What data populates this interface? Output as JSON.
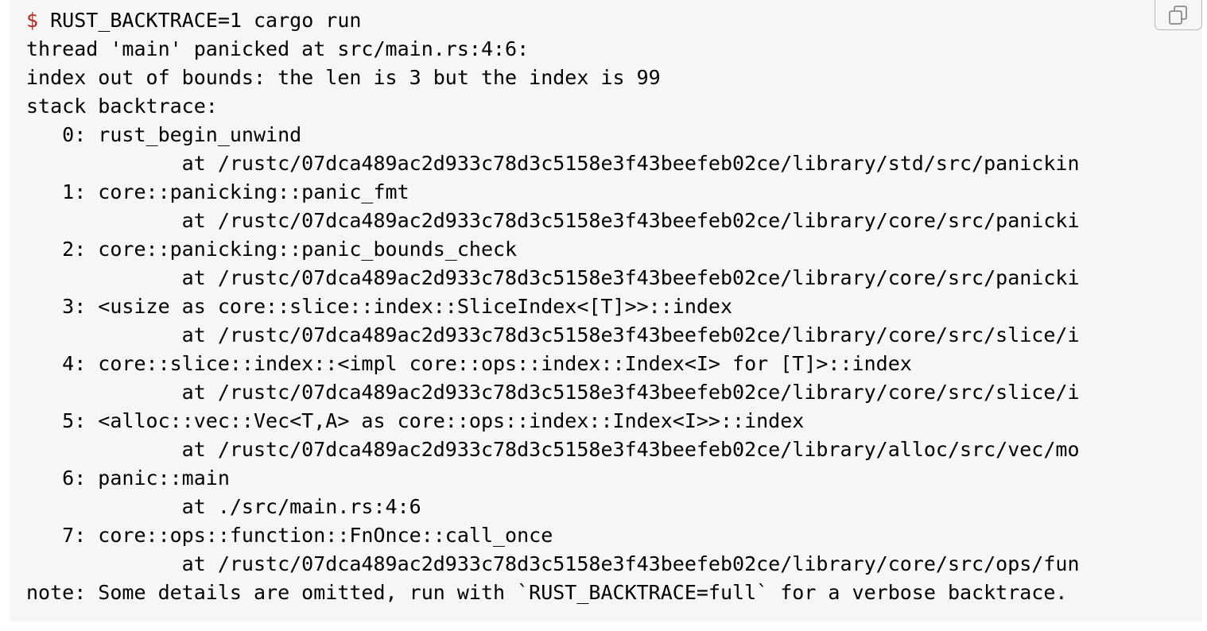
{
  "code_block": {
    "prompt_symbol": "$",
    "command": "RUST_BACKTRACE=1 cargo run",
    "lines": [
      "thread 'main' panicked at src/main.rs:4:6:",
      "index out of bounds: the len is 3 but the index is 99",
      "stack backtrace:",
      "   0: rust_begin_unwind",
      "             at /rustc/07dca489ac2d933c78d3c5158e3f43beefeb02ce/library/std/src/panickin",
      "   1: core::panicking::panic_fmt",
      "             at /rustc/07dca489ac2d933c78d3c5158e3f43beefeb02ce/library/core/src/panicki",
      "   2: core::panicking::panic_bounds_check",
      "             at /rustc/07dca489ac2d933c78d3c5158e3f43beefeb02ce/library/core/src/panicki",
      "   3: <usize as core::slice::index::SliceIndex<[T]>>::index",
      "             at /rustc/07dca489ac2d933c78d3c5158e3f43beefeb02ce/library/core/src/slice/i",
      "   4: core::slice::index::<impl core::ops::index::Index<I> for [T]>::index",
      "             at /rustc/07dca489ac2d933c78d3c5158e3f43beefeb02ce/library/core/src/slice/i",
      "   5: <alloc::vec::Vec<T,A> as core::ops::index::Index<I>>::index",
      "             at /rustc/07dca489ac2d933c78d3c5158e3f43beefeb02ce/library/alloc/src/vec/mo",
      "   6: panic::main",
      "             at ./src/main.rs:4:6",
      "   7: core::ops::function::FnOnce::call_once",
      "             at /rustc/07dca489ac2d933c78d3c5158e3f43beefeb02ce/library/core/src/ops/fun",
      "note: Some details are omitted, run with `RUST_BACKTRACE=full` for a verbose backtrace."
    ]
  },
  "copy_button": {
    "icon": "copy-icon"
  },
  "colors": {
    "background": "#f6f6f6",
    "prompt": "#b0261f",
    "text": "#000000"
  }
}
